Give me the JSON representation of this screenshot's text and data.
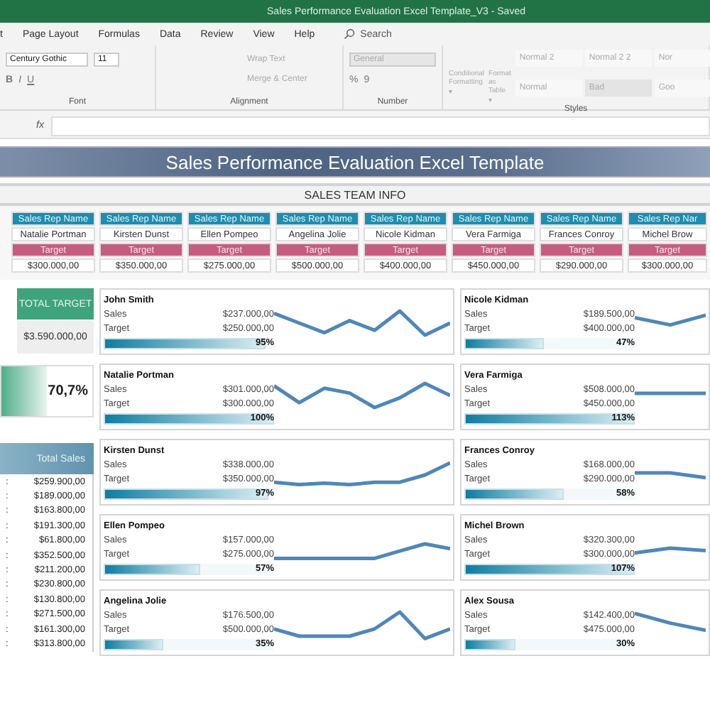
{
  "title_bar": {
    "title": "Sales Performance Evaluation Excel Template_V3  -  Saved"
  },
  "menu_tabs": [
    "t",
    "Page Layout",
    "Formulas",
    "Data",
    "Review",
    "View",
    "Help"
  ],
  "search": {
    "placeholder": "Search"
  },
  "ribbon": {
    "font_name": "Century Gothic",
    "font_size": "11",
    "format_buttons": [
      "B",
      "I",
      "U"
    ],
    "wrap_text": "Wrap Text",
    "merge": "Merge & Center",
    "number_format": "General",
    "number_buttons": [
      "%",
      "9"
    ],
    "conditional": "Conditional Formatting ▾",
    "format_table": "Format as Table ▾",
    "styles": [
      "Normal 2",
      "Normal 2 2",
      "Nor",
      "Normal",
      "Bad",
      "Goo"
    ],
    "groups": [
      "Font",
      "Alignment",
      "Number",
      "Styles"
    ]
  },
  "formula_bar": {
    "fx": "fx"
  },
  "sheet": {
    "banner": "Sales Performance Evaluation Excel Template",
    "team_heading": "SALES TEAM INFO",
    "reps": [
      {
        "header": "Sales Rep Name",
        "name": "Natalie Portman",
        "target_label": "Target",
        "target": "$300.000,00"
      },
      {
        "header": "Sales Rep Name",
        "name": "Kirsten Dunst",
        "target_label": "Target",
        "target": "$350.000,00"
      },
      {
        "header": "Sales Rep Name",
        "name": "Ellen Pompeo",
        "target_label": "Target",
        "target": "$275.000,00"
      },
      {
        "header": "Sales Rep Name",
        "name": "Angelina Jolie",
        "target_label": "Target",
        "target": "$500.000,00"
      },
      {
        "header": "Sales Rep Name",
        "name": "Nicole Kidman",
        "target_label": "Target",
        "target": "$400.000,00"
      },
      {
        "header": "Sales Rep Name",
        "name": "Vera Farmiga",
        "target_label": "Target",
        "target": "$450.000,00"
      },
      {
        "header": "Sales Rep Name",
        "name": "Frances Conroy",
        "target_label": "Target",
        "target": "$290.000,00"
      },
      {
        "header": "Sales Rep Nar",
        "name": "Michel Brow",
        "target_label": "Target",
        "target": "$300.000,00"
      }
    ],
    "total_target": {
      "label": "TOTAL TARGET",
      "value": "$3.590.000,00"
    },
    "achievement": {
      "value": "70,7%"
    },
    "total_sales": {
      "label": "Total Sales",
      "rows": [
        {
          "sep": ":",
          "value": "$259.900,00"
        },
        {
          "sep": ":",
          "value": "$189.000,00"
        },
        {
          "sep": ":",
          "value": "$163.800,00"
        },
        {
          "sep": ":",
          "value": "$191.300,00"
        },
        {
          "sep": ":",
          "value": "$61.800,00"
        },
        {
          "sep": ":",
          "value": "$352.500,00"
        },
        {
          "sep": ":",
          "value": "$211.200,00"
        },
        {
          "sep": ":",
          "value": "$230.800,00"
        },
        {
          "sep": ":",
          "value": "$130.800,00"
        },
        {
          "sep": ":",
          "value": "$271.500,00"
        },
        {
          "sep": ":",
          "value": "$161.300,00"
        },
        {
          "sep": ":",
          "value": "$313.800,00"
        }
      ]
    },
    "card_columns": [
      {
        "cards": [
          {
            "name": "John Smith",
            "sales_label": "Sales",
            "sales": "$237.000,00",
            "target_label": "Target",
            "target": "$250.000,00",
            "percent": "95%",
            "level": 0.95
          },
          {
            "name": "Natalie Portman",
            "sales_label": "Sales",
            "sales": "$301.000,00",
            "target_label": "Target",
            "target": "$300.000,00",
            "percent": "100%",
            "level": 1
          },
          {
            "name": "Kirsten Dunst",
            "sales_label": "Sales",
            "sales": "$338.000,00",
            "target_label": "Target",
            "target": "$350.000,00",
            "percent": "97%",
            "level": 0.97
          },
          {
            "name": "Ellen Pompeo",
            "sales_label": "Sales",
            "sales": "$157.000,00",
            "target_label": "Target",
            "target": "$275.000,00",
            "percent": "57%",
            "level": 0.57
          },
          {
            "name": "Angelina Jolie",
            "sales_label": "Sales",
            "sales": "$176.500,00",
            "target_label": "Target",
            "target": "$500.000,00",
            "percent": "35%",
            "level": 0.35
          }
        ]
      },
      {
        "cards": [
          {
            "name": "Nicole Kidman",
            "sales_label": "Sales",
            "sales": "$189.500,00",
            "target_label": "Target",
            "target": "$400.000,00",
            "percent": "47%",
            "level": 0.47
          },
          {
            "name": "Vera Farmiga",
            "sales_label": "Sales",
            "sales": "$508.000,00",
            "target_label": "Target",
            "target": "$450.000,00",
            "percent": "113%",
            "level": 1
          },
          {
            "name": "Frances Conroy",
            "sales_label": "Sales",
            "sales": "$168.000,00",
            "target_label": "Target",
            "target": "$290.000,00",
            "percent": "58%",
            "level": 0.58
          },
          {
            "name": "Michel Brown",
            "sales_label": "Sales",
            "sales": "$320.300,00",
            "target_label": "Target",
            "target": "$300.000,00",
            "percent": "107%",
            "level": 1
          },
          {
            "name": "Alex Sousa",
            "sales_label": "Sales",
            "sales": "$142.400,00",
            "target_label": "Target",
            "target": "$475.000,00",
            "percent": "30%",
            "level": 0.3
          }
        ]
      }
    ]
  }
}
